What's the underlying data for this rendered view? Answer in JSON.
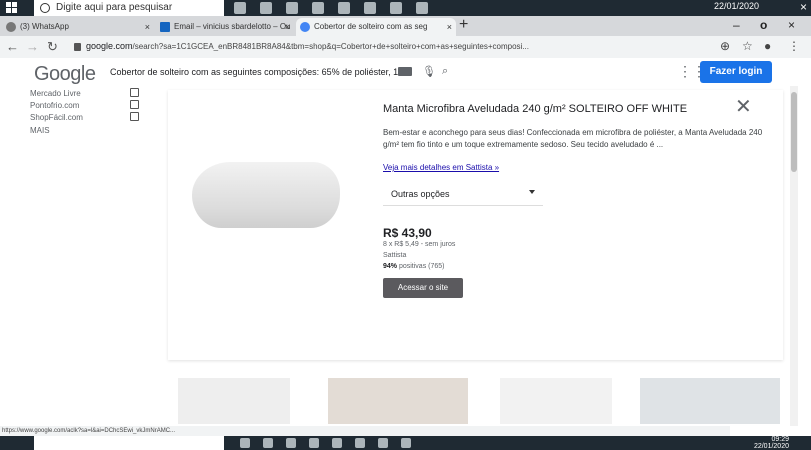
{
  "taskbar": {
    "search_placeholder": "Digite aqui para pesquisar",
    "date": "22/01/2020"
  },
  "tabs": [
    {
      "label": "(3) WhatsApp"
    },
    {
      "label": "Email – vinicius sbardelotto – Ou"
    },
    {
      "label": "Cobertor de solteiro com as seg"
    }
  ],
  "address": {
    "host": "google.com",
    "path": "/search?sa=1C1GCEA_enBR8481BR8A84&tbm=shop&q=Cobertor+de+solteiro+com+as+seguintes+composi..."
  },
  "header": {
    "logo": "Google",
    "query": "Cobertor de solteiro com as seguintes composições: 65% de poliéster, 15%",
    "login": "Fazer login"
  },
  "filters": {
    "items": [
      {
        "label": "Mercado Livre"
      },
      {
        "label": "Pontofrio.com"
      },
      {
        "label": "ShopFácil.com"
      }
    ],
    "more": "MAIS"
  },
  "product": {
    "title": "Manta Microfibra Aveludada 240 g/m² SOLTEIRO OFF WHITE",
    "description": "Bem-estar e aconchego para seus dias! Confeccionada em microfibra de poliéster, a Manta Aveludada 240 g/m² tem fio tinto e um toque extremamente sedoso. Seu tecido aveludado é ...",
    "more_link": "Veja mais detalhes em Sattista »",
    "options_label": "Outras opções",
    "price": "R$ 43,90",
    "installments": "8 x R$ 5,49 - sem juros",
    "store": "Sattista",
    "rating_pct": "94%",
    "rating_text": "positivas (765)",
    "button": "Acessar o site"
  },
  "status_url": "https://www.google.com/aclk?sa=l&ai=DChcSEwi_vkJmNrAMC...",
  "clock": {
    "time": "09:29",
    "date": "22/01/2020"
  }
}
